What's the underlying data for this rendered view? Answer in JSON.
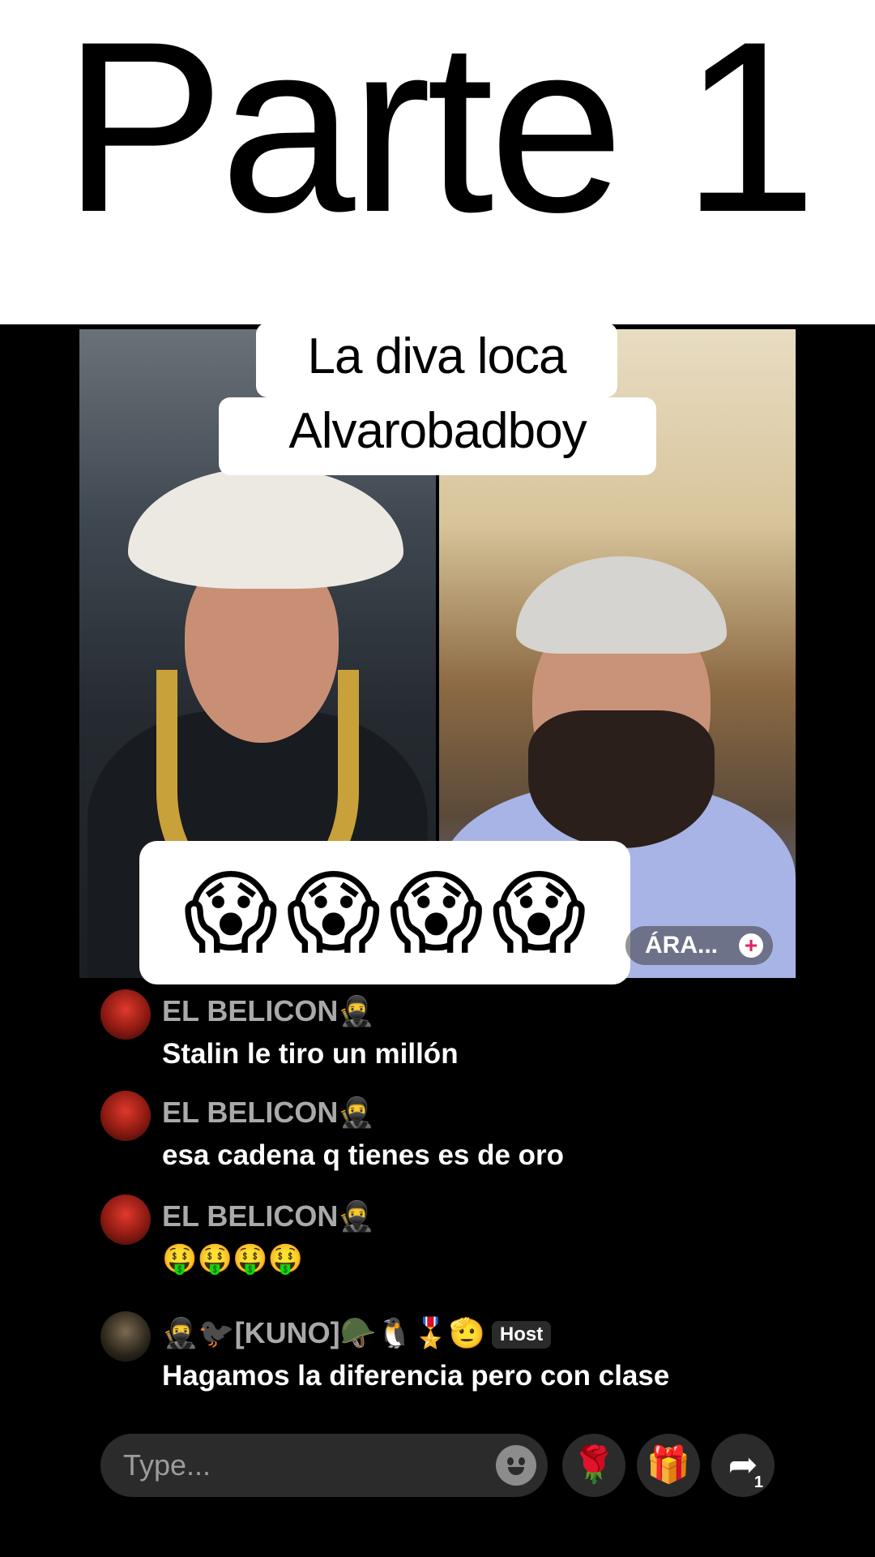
{
  "banner": {
    "title": "Parte 1"
  },
  "caption": {
    "line1": "La diva loca",
    "line2": "Alvarobadboy"
  },
  "reaction": {
    "emojis": [
      "😱",
      "😱",
      "😱",
      "😱"
    ]
  },
  "guest_pill": {
    "label": "ÁRA...",
    "plus": "+"
  },
  "comments": [
    {
      "user": "EL BELICON🥷",
      "text": "Stalin le tiro un millón"
    },
    {
      "user": "EL BELICON🥷",
      "text": "esa cadena q tienes es de oro"
    },
    {
      "user": "EL BELICON🥷",
      "text": "🤑🤑🤑🤑"
    },
    {
      "user": "🥷🐦‍⬛[KUNO]🪖🐧🎖️🫡",
      "badge": "Host",
      "text": "Hagamos la diferencia pero con clase"
    }
  ],
  "composer": {
    "placeholder": "Type...",
    "rose_icon": "🌹",
    "gift_icon": "🎁",
    "share_icon": "➦",
    "share_count": "1"
  }
}
